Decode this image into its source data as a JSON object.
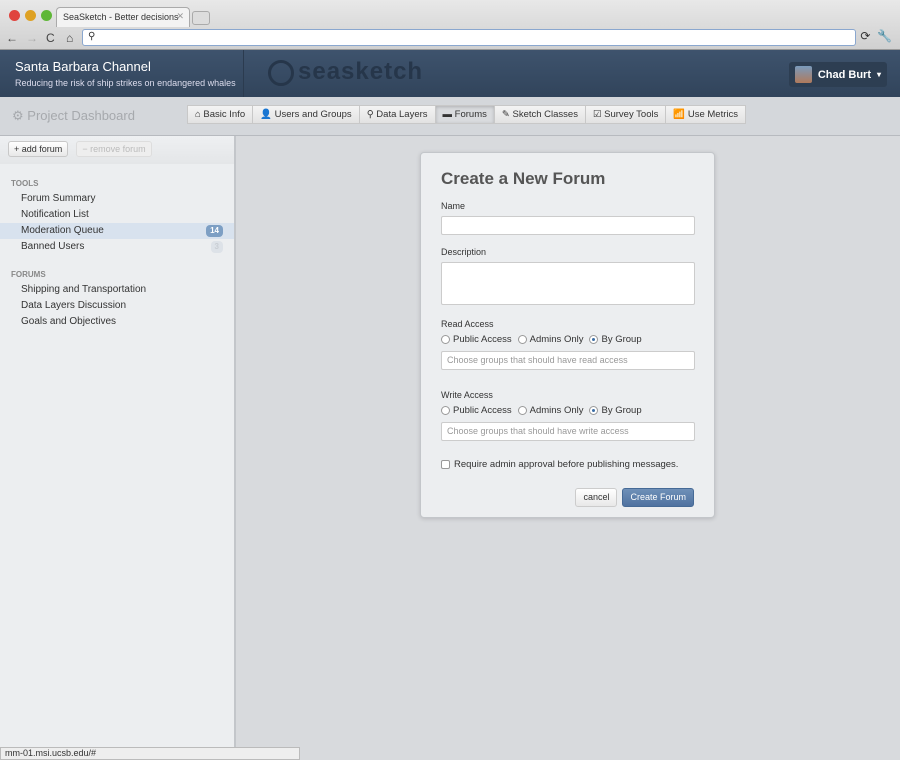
{
  "browser": {
    "tab_title": "SeaSketch - Better decisions",
    "url": ""
  },
  "header": {
    "project": "Santa Barbara Channel",
    "subtitle": "Reducing the risk of ship strikes on endangered whales",
    "logo": "seasketch",
    "user": "Chad Burt"
  },
  "subnav": {
    "title": "Project Dashboard",
    "tabs": [
      {
        "icon": "home-icon",
        "glyph": "⌂",
        "label": "Basic Info"
      },
      {
        "icon": "user-icon",
        "glyph": "👤",
        "label": "Users and Groups"
      },
      {
        "icon": "map-marker-icon",
        "glyph": "⚲",
        "label": "Data Layers"
      },
      {
        "icon": "comment-icon",
        "glyph": "▬",
        "label": "Forums"
      },
      {
        "icon": "pencil-icon",
        "glyph": "✎",
        "label": "Sketch Classes"
      },
      {
        "icon": "check-icon",
        "glyph": "☑",
        "label": "Survey Tools"
      },
      {
        "icon": "signal-icon",
        "glyph": "📶",
        "label": "Use Metrics"
      }
    ]
  },
  "sidebar": {
    "add_label": "add forum",
    "remove_label": "remove forum",
    "tools_header": "TOOLS",
    "tools": [
      {
        "label": "Forum Summary"
      },
      {
        "label": "Notification List"
      },
      {
        "label": "Moderation Queue",
        "badge": "14"
      },
      {
        "label": "Banned Users",
        "badge": "3"
      }
    ],
    "forums_header": "FORUMS",
    "forums": [
      {
        "label": "Shipping and Transportation"
      },
      {
        "label": "Data Layers Discussion"
      },
      {
        "label": "Goals and Objectives"
      }
    ]
  },
  "form": {
    "title": "Create a New Forum",
    "name_label": "Name",
    "name_value": "",
    "description_label": "Description",
    "read_label": "Read Access",
    "write_label": "Write Access",
    "opt_public": "Public Access",
    "opt_admins": "Admins Only",
    "opt_group": "By Group",
    "read_selected": "By Group",
    "write_selected": "By Group",
    "read_placeholder": "Choose groups that should have read access",
    "write_placeholder": "Choose groups that should have write access",
    "approval_label": "Require admin approval before publishing messages.",
    "approval_checked": false,
    "cancel": "cancel",
    "submit": "Create Forum"
  },
  "status_url": "mm-01.msi.ucsb.edu/#"
}
